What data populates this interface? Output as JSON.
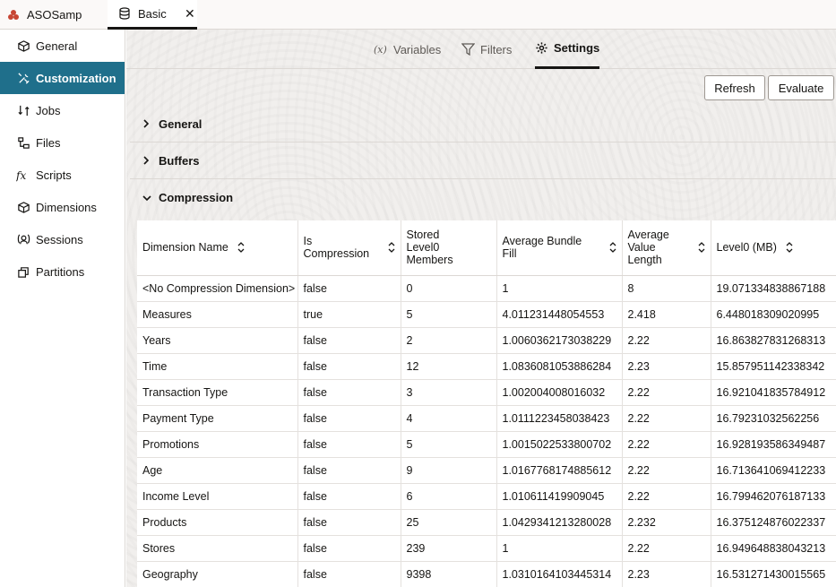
{
  "tabs": {
    "app_label": "ASOSamp",
    "db_label": "Basic",
    "close_symbol": "✕"
  },
  "sidebar": {
    "items": [
      {
        "label": "General",
        "icon": "cube-icon",
        "active": false
      },
      {
        "label": "Customization",
        "icon": "tools-icon",
        "active": true
      },
      {
        "label": "Jobs",
        "icon": "jobs-icon",
        "active": false
      },
      {
        "label": "Files",
        "icon": "files-icon",
        "active": false
      },
      {
        "label": "Scripts",
        "icon": "fx-icon",
        "active": false
      },
      {
        "label": "Dimensions",
        "icon": "dimensions-icon",
        "active": false
      },
      {
        "label": "Sessions",
        "icon": "sessions-icon",
        "active": false
      },
      {
        "label": "Partitions",
        "icon": "partitions-icon",
        "active": false
      }
    ]
  },
  "subtabs": {
    "variables": "Variables",
    "filters": "Filters",
    "settings": "Settings",
    "active": "Settings"
  },
  "buttons": {
    "refresh": "Refresh",
    "evaluate": "Evaluate"
  },
  "sections": {
    "general": "General",
    "buffers": "Buffers",
    "compression": "Compression"
  },
  "table": {
    "headers": [
      "Dimension Name",
      "Is Compression",
      "Stored Level0 Members",
      "Average Bundle Fill",
      "Average Value Length",
      "Level0 (MB)"
    ],
    "rows": [
      [
        "<No Compression Dimension>",
        "false",
        "0",
        "1",
        "8",
        "19.071334838867188"
      ],
      [
        "Measures",
        "true",
        "5",
        "4.011231448054553",
        "2.418",
        "6.448018309020995"
      ],
      [
        "Years",
        "false",
        "2",
        "1.0060362173038229",
        "2.22",
        "16.863827831268313"
      ],
      [
        "Time",
        "false",
        "12",
        "1.0836081053886284",
        "2.23",
        "15.857951142338342"
      ],
      [
        "Transaction Type",
        "false",
        "3",
        "1.002004008016032",
        "2.22",
        "16.921041835784912"
      ],
      [
        "Payment Type",
        "false",
        "4",
        "1.0111223458038423",
        "2.22",
        "16.79231032562256"
      ],
      [
        "Promotions",
        "false",
        "5",
        "1.0015022533800702",
        "2.22",
        "16.928193586349487"
      ],
      [
        "Age",
        "false",
        "9",
        "1.0167768174885612",
        "2.22",
        "16.713641069412233"
      ],
      [
        "Income Level",
        "false",
        "6",
        "1.010611419909045",
        "2.22",
        "16.799462076187133"
      ],
      [
        "Products",
        "false",
        "25",
        "1.0429341213280028",
        "2.232",
        "16.375124876022337"
      ],
      [
        "Stores",
        "false",
        "239",
        "1",
        "2.22",
        "16.949648838043213"
      ],
      [
        "Geography",
        "false",
        "9398",
        "1.0310164103445314",
        "2.23",
        "16.531271430015565"
      ]
    ]
  },
  "colors": {
    "accent": "#1f6f8b",
    "app_icon": "#c74634",
    "background": "#f1efed"
  }
}
